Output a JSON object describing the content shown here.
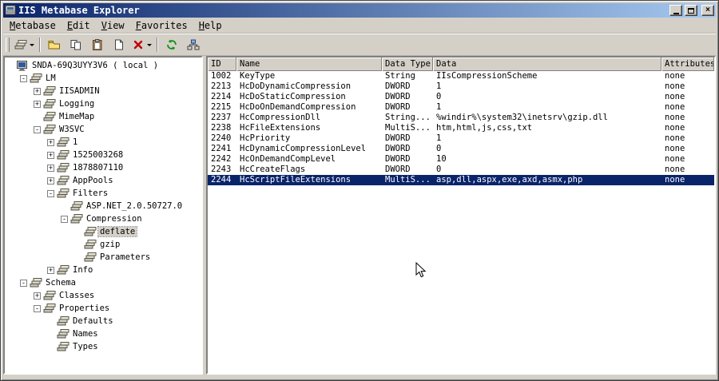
{
  "window": {
    "title": "IIS Metabase Explorer"
  },
  "menu": {
    "items": [
      {
        "label": "Metabase"
      },
      {
        "label": "Edit"
      },
      {
        "label": "View"
      },
      {
        "label": "Favorites"
      },
      {
        "label": "Help"
      }
    ]
  },
  "toolbar": {
    "buttons": [
      {
        "name": "new-key",
        "icon": "new-key-icon",
        "dropdown": true
      },
      {
        "separator": true
      },
      {
        "name": "export",
        "icon": "folder-icon"
      },
      {
        "name": "copy",
        "icon": "copy-icon"
      },
      {
        "name": "paste",
        "icon": "paste-icon"
      },
      {
        "name": "new-value",
        "icon": "document-icon"
      },
      {
        "name": "delete",
        "icon": "delete-icon",
        "dropdown": true
      },
      {
        "separator": true
      },
      {
        "name": "refresh",
        "icon": "refresh-icon"
      },
      {
        "name": "connect",
        "icon": "network-icon"
      }
    ]
  },
  "tree": {
    "items": [
      {
        "label": "SNDA-69Q3UYY3V6 ( local )",
        "depth": 0,
        "expander": "none",
        "icon": "computer"
      },
      {
        "label": "LM",
        "depth": 1,
        "expander": "minus",
        "icon": "key"
      },
      {
        "label": "IISADMIN",
        "depth": 2,
        "expander": "plus",
        "icon": "key"
      },
      {
        "label": "Logging",
        "depth": 2,
        "expander": "plus",
        "icon": "key"
      },
      {
        "label": "MimeMap",
        "depth": 2,
        "expander": "none",
        "icon": "key"
      },
      {
        "label": "W3SVC",
        "depth": 2,
        "expander": "minus",
        "icon": "key"
      },
      {
        "label": "1",
        "depth": 3,
        "expander": "plus",
        "icon": "key"
      },
      {
        "label": "1525003268",
        "depth": 3,
        "expander": "plus",
        "icon": "key"
      },
      {
        "label": "1878807110",
        "depth": 3,
        "expander": "plus",
        "icon": "key"
      },
      {
        "label": "AppPools",
        "depth": 3,
        "expander": "plus",
        "icon": "key"
      },
      {
        "label": "Filters",
        "depth": 3,
        "expander": "minus",
        "icon": "key"
      },
      {
        "label": "ASP.NET_2.0.50727.0",
        "depth": 4,
        "expander": "none",
        "icon": "key"
      },
      {
        "label": "Compression",
        "depth": 4,
        "expander": "minus",
        "icon": "key"
      },
      {
        "label": "deflate",
        "depth": 5,
        "expander": "none",
        "icon": "key",
        "selected": true
      },
      {
        "label": "gzip",
        "depth": 5,
        "expander": "none",
        "icon": "key"
      },
      {
        "label": "Parameters",
        "depth": 5,
        "expander": "none",
        "icon": "key"
      },
      {
        "label": "Info",
        "depth": 3,
        "expander": "plus",
        "icon": "key"
      },
      {
        "label": "Schema",
        "depth": 1,
        "expander": "minus",
        "icon": "key"
      },
      {
        "label": "Classes",
        "depth": 2,
        "expander": "plus",
        "icon": "key"
      },
      {
        "label": "Properties",
        "depth": 2,
        "expander": "minus",
        "icon": "key"
      },
      {
        "label": "Defaults",
        "depth": 3,
        "expander": "none",
        "icon": "key"
      },
      {
        "label": "Names",
        "depth": 3,
        "expander": "none",
        "icon": "key"
      },
      {
        "label": "Types",
        "depth": 3,
        "expander": "none",
        "icon": "key"
      }
    ]
  },
  "table": {
    "columns": [
      "ID",
      "Name",
      "Data Type",
      "Data",
      "Attributes"
    ],
    "rows": [
      [
        "1002",
        "KeyType",
        "String",
        "IIsCompressionScheme",
        "none"
      ],
      [
        "2213",
        "HcDoDynamicCompression",
        "DWORD",
        "1",
        "none"
      ],
      [
        "2214",
        "HcDoStaticCompression",
        "DWORD",
        "0",
        "none"
      ],
      [
        "2215",
        "HcDoOnDemandCompression",
        "DWORD",
        "1",
        "none"
      ],
      [
        "2237",
        "HcCompressionDll",
        "String...",
        "%windir%\\system32\\inetsrv\\gzip.dll",
        "none"
      ],
      [
        "2238",
        "HcFileExtensions",
        "MultiS...",
        "htm,html,js,css,txt",
        "none"
      ],
      [
        "2240",
        "HcPriority",
        "DWORD",
        "1",
        "none"
      ],
      [
        "2241",
        "HcDynamicCompressionLevel",
        "DWORD",
        "0",
        "none"
      ],
      [
        "2242",
        "HcOnDemandCompLevel",
        "DWORD",
        "10",
        "none"
      ],
      [
        "2243",
        "HcCreateFlags",
        "DWORD",
        "0",
        "none"
      ],
      [
        "2244",
        "HcScriptFileExtensions",
        "MultiS...",
        "asp,dll,aspx,exe,axd,asmx,php",
        "none"
      ]
    ],
    "selected_row": 10
  },
  "colors": {
    "titlebar_start": "#0a246a",
    "titlebar_end": "#a6caf0",
    "selection": "#0a246a",
    "chrome": "#d4d0c8"
  }
}
